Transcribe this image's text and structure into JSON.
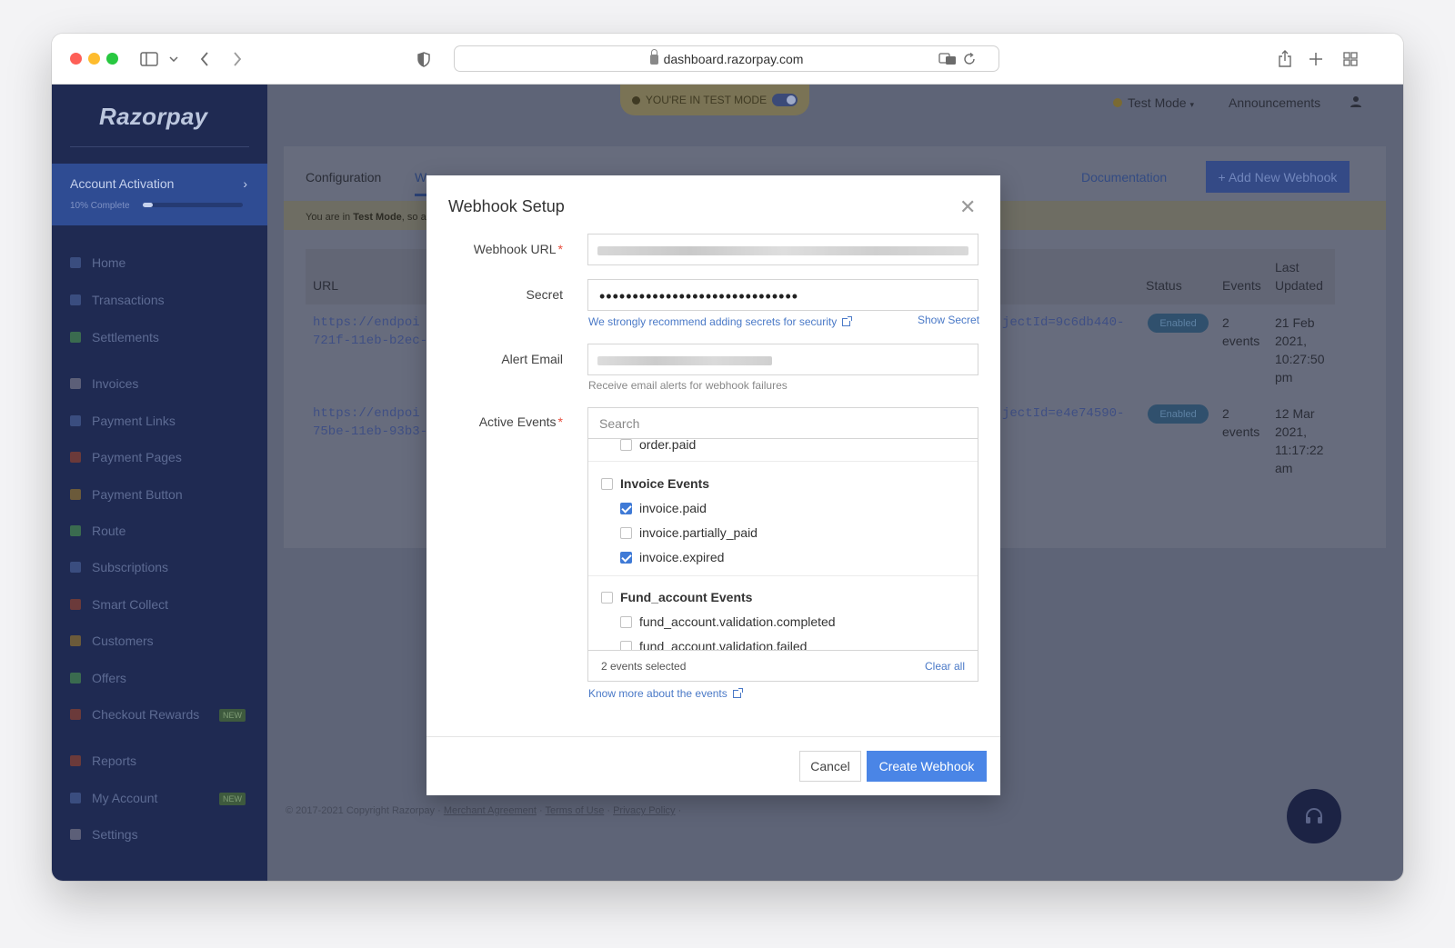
{
  "browser": {
    "url": "dashboard.razorpay.com"
  },
  "sidebar": {
    "logo": "Razorpay",
    "activation": {
      "title": "Account Activation",
      "progress_label": "10% Complete",
      "progress": 0.1
    },
    "items": [
      {
        "label": "Home",
        "icon": "home-icon",
        "color": "#3a4d7f"
      },
      {
        "label": "Transactions",
        "icon": "transactions-icon",
        "color": "#3a4d7f"
      },
      {
        "label": "Settlements",
        "icon": "settlements-icon",
        "color": "#3a6b4f"
      },
      {
        "label": "Invoices",
        "icon": "invoices-icon",
        "color": "#5c5f78"
      },
      {
        "label": "Payment Links",
        "icon": "link-icon",
        "color": "#3a4d7f"
      },
      {
        "label": "Payment Pages",
        "icon": "pages-icon",
        "color": "#6b3a3a"
      },
      {
        "label": "Payment Button",
        "icon": "button-icon",
        "color": "#6b5a3a"
      },
      {
        "label": "Route",
        "icon": "route-icon",
        "color": "#3a6b4f"
      },
      {
        "label": "Subscriptions",
        "icon": "subscriptions-icon",
        "color": "#3a4d7f"
      },
      {
        "label": "Smart Collect",
        "icon": "bank-icon",
        "color": "#6b3a3a"
      },
      {
        "label": "Customers",
        "icon": "customers-icon",
        "color": "#6b5a3a"
      },
      {
        "label": "Offers",
        "icon": "offers-icon",
        "color": "#3a6b4f"
      },
      {
        "label": "Checkout Rewards",
        "icon": "gift-icon",
        "color": "#6b3a3a",
        "badge": "NEW"
      },
      {
        "label": "Reports",
        "icon": "reports-icon",
        "color": "#6b3a3a"
      },
      {
        "label": "My Account",
        "icon": "account-icon",
        "color": "#3a4d7f",
        "badge": "NEW"
      },
      {
        "label": "Settings",
        "icon": "gear-icon",
        "color": "#5c5f78"
      }
    ]
  },
  "header": {
    "test_mode_banner": "YOU'RE IN TEST MODE",
    "mode_dropdown": "Test Mode",
    "announcements": "Announcements"
  },
  "page": {
    "tab_configuration": "Configuration",
    "tab_webhooks": "W",
    "documentation": "Documentation",
    "add_button": "+ Add New Webhook",
    "notice_prefix": "You are in ",
    "notice_bold": "Test Mode",
    "notice_suffix": ", so a",
    "columns": {
      "url": "URL",
      "status": "Status",
      "events": "Events",
      "last_updated_1": "Last",
      "last_updated_2": "Updated"
    },
    "rows": [
      {
        "url_1": "https://endpoi",
        "url_2": "721f-11eb-b2ec-",
        "url_tail": "jectId=9c6db440-",
        "status": "Enabled",
        "events_1": "2",
        "events_2": "events",
        "updated": [
          "21 Feb",
          "2021,",
          "10:27:50",
          "pm"
        ]
      },
      {
        "url_1": "https://endpoi",
        "url_2": "75be-11eb-93b3-",
        "url_tail": "jectId=e4e74590-",
        "status": "Enabled",
        "events_1": "2",
        "events_2": "events",
        "updated": [
          "12 Mar",
          "2021,",
          "11:17:22",
          "am"
        ]
      }
    ],
    "footer": {
      "copyright": "© 2017-2021 Copyright Razorpay · ",
      "merchant": "Merchant Agreement",
      "sep1": " · ",
      "terms": "Terms of Use",
      "sep2": " · ",
      "privacy": "Privacy Policy",
      "sep3": " ·"
    }
  },
  "modal": {
    "title": "Webhook Setup",
    "webhook_url_label": "Webhook URL",
    "secret_label": "Secret",
    "secret_value": "••••••••••••••••••••••••••••••",
    "secret_hint": "We strongly recommend adding secrets for security",
    "show_secret": "Show Secret",
    "alert_email_label": "Alert Email",
    "alert_email_hint": "Receive email alerts for webhook failures",
    "active_events_label": "Active Events",
    "search_placeholder": "Search",
    "events": [
      {
        "label": "order.paid",
        "checked": false,
        "group": false
      },
      {
        "label": "Invoice Events",
        "checked": false,
        "group": true
      },
      {
        "label": "invoice.paid",
        "checked": true,
        "group": false
      },
      {
        "label": "invoice.partially_paid",
        "checked": false,
        "group": false
      },
      {
        "label": "invoice.expired",
        "checked": true,
        "group": false
      },
      {
        "label": "Fund_account Events",
        "checked": false,
        "group": true
      },
      {
        "label": "fund_account.validation.completed",
        "checked": false,
        "group": false
      },
      {
        "label": "fund_account.validation.failed",
        "checked": false,
        "group": false
      }
    ],
    "selected_count": "2 events selected",
    "clear_all": "Clear all",
    "know_more": "Know more about the events",
    "cancel": "Cancel",
    "create": "Create Webhook"
  },
  "colors": {
    "accent": "#4a85e6",
    "link": "#4a79c7",
    "sidebar": "#1f2a52",
    "overlay": "#5e6477"
  }
}
